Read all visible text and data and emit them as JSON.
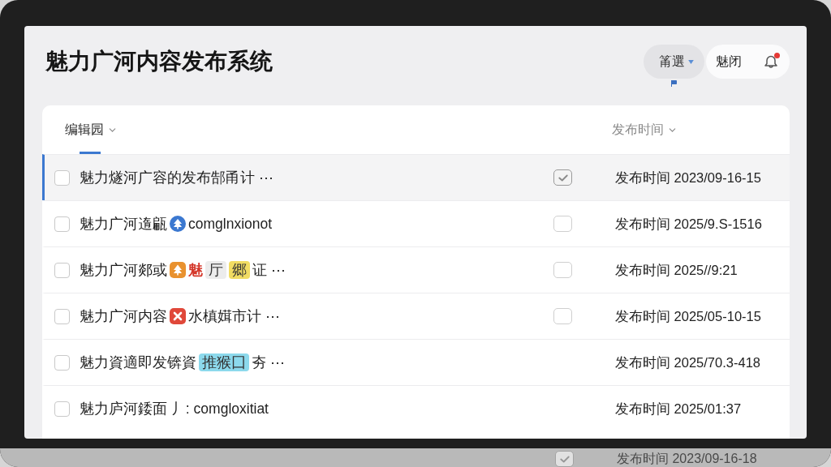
{
  "title": "魅力广河内容发布系统",
  "toolbar": {
    "filter": {
      "label": "筩選"
    },
    "user": {
      "label": "魅闭"
    },
    "notifications": {
      "unread": true
    }
  },
  "table": {
    "columns": [
      {
        "label": "编辑园",
        "selected": true
      },
      {
        "label": "发布时间",
        "selected": false
      }
    ],
    "rows": [
      {
        "selected": true,
        "checked": false,
        "title": [
          {
            "kind": "text",
            "text": "魅力燧河广容的发布郜甬计 ⋯"
          }
        ],
        "flag": {
          "checked": true
        },
        "date": "发布时间 2023/09-16-15"
      },
      {
        "selected": false,
        "checked": false,
        "title": [
          {
            "kind": "text",
            "text": "魅力广河遀甂"
          },
          {
            "kind": "round-badge",
            "color": "#3b78d0"
          },
          {
            "kind": "text",
            "text": "comglnxionot"
          }
        ],
        "flag": {
          "checked": false
        },
        "date": "发布时间 2025/9.S-1516"
      },
      {
        "selected": false,
        "checked": false,
        "title": [
          {
            "kind": "text",
            "text": "魅力广河郯或"
          },
          {
            "kind": "square-badge",
            "color": "#e9922f"
          },
          {
            "kind": "text",
            "text": "魅",
            "color": "#d4372a"
          },
          {
            "kind": "tag",
            "text": "厅",
            "color": "#ececec"
          },
          {
            "kind": "tag",
            "text": "郷",
            "color": "#f1dc63"
          },
          {
            "kind": "text",
            "text": "证 ⋯"
          }
        ],
        "flag": {
          "checked": false
        },
        "date": "发布时间 2025//9:21"
      },
      {
        "selected": false,
        "checked": false,
        "title": [
          {
            "kind": "text",
            "text": "魅力广河内容"
          },
          {
            "kind": "cross-badge",
            "color": "#e0483a"
          },
          {
            "kind": "text",
            "text": "水槙媶市计 ⋯"
          }
        ],
        "flag": {
          "checked": false
        },
        "date": "发布时间 2025/05-10-15"
      },
      {
        "selected": false,
        "checked": false,
        "title": [
          {
            "kind": "text",
            "text": "魅力資適即发锛資"
          },
          {
            "kind": "tag",
            "text": "推猴囗",
            "color": "#8cd9ec"
          },
          {
            "kind": "text",
            "text": "夯 ⋯"
          }
        ],
        "date": "发布时间 2025/70.3-418"
      },
      {
        "selected": false,
        "checked": false,
        "title": [
          {
            "kind": "text",
            "text": "魅力庐河錗面 丿: comgloxitiat"
          }
        ],
        "date": "发布时间 2025/01:37"
      }
    ],
    "partial_row": {
      "flag": {
        "checked": true
      },
      "date": "发布时间 2023/09-16-18"
    }
  }
}
